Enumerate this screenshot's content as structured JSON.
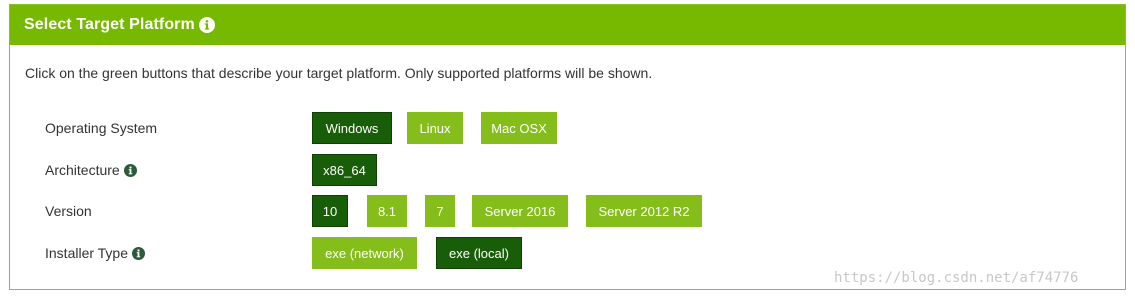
{
  "header": {
    "title": "Select Target Platform",
    "info_icon": "info-circle-icon"
  },
  "description": "Click on the green buttons that describe your target platform. Only supported platforms will be shown.",
  "rows": [
    {
      "label": "Operating System",
      "has_info": false,
      "options": [
        {
          "label": "Windows",
          "selected": true
        },
        {
          "label": "Linux",
          "selected": false
        },
        {
          "label": "Mac OSX",
          "selected": false
        }
      ]
    },
    {
      "label": "Architecture",
      "has_info": true,
      "options": [
        {
          "label": "x86_64",
          "selected": true
        }
      ]
    },
    {
      "label": "Version",
      "has_info": false,
      "options": [
        {
          "label": "10",
          "selected": true
        },
        {
          "label": "8.1",
          "selected": false
        },
        {
          "label": "7",
          "selected": false
        },
        {
          "label": "Server 2016",
          "selected": false
        },
        {
          "label": "Server 2012 R2",
          "selected": false
        }
      ]
    },
    {
      "label": "Installer Type",
      "has_info": true,
      "options": [
        {
          "label": "exe (network)",
          "selected": false
        },
        {
          "label": "exe (local)",
          "selected": true
        }
      ]
    }
  ],
  "colors": {
    "header_bg": "#76b900",
    "button_bg": "#85bd1a",
    "button_selected_bg": "#185d07"
  },
  "watermark": "https://blog.csdn.net/af74776"
}
